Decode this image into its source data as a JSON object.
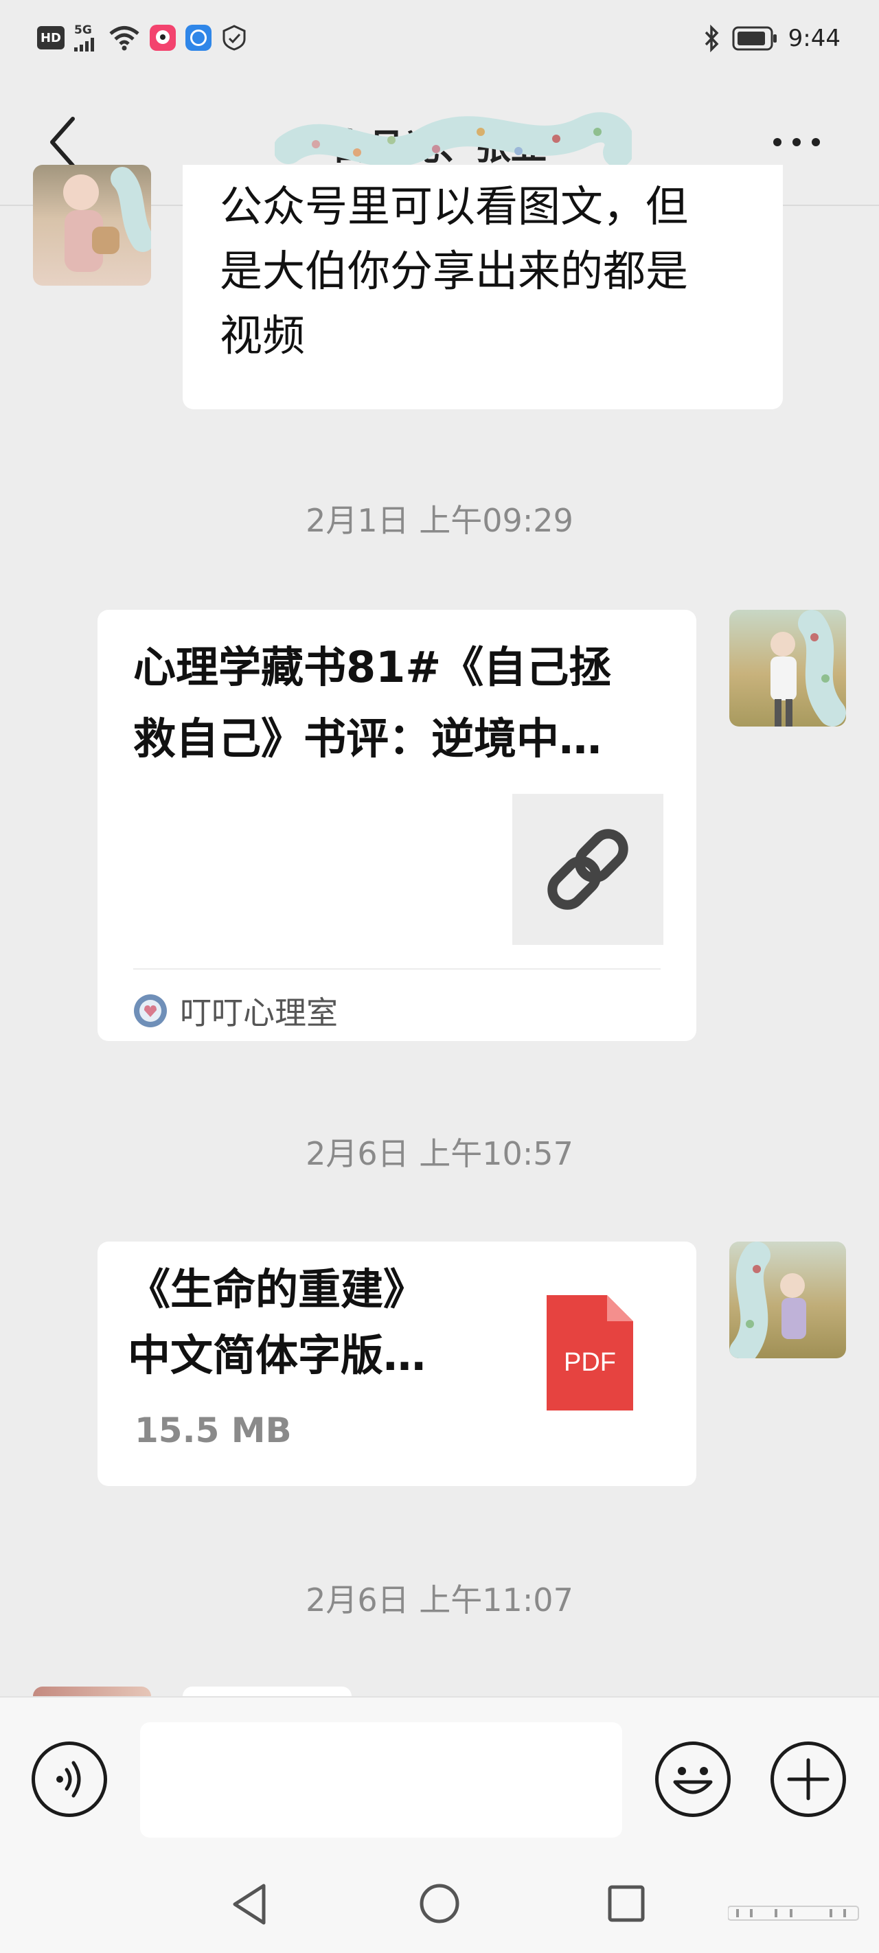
{
  "status_bar": {
    "hd": "HD",
    "network": "5G",
    "time": "9:44"
  },
  "nav": {
    "title": "白月光、张亚"
  },
  "messages": [
    {
      "type": "text",
      "side": "left",
      "text_lines": [
        "公众号里可以看图文，但",
        "是大伯你分享出来的都是",
        "视频"
      ]
    },
    {
      "type": "timestamp",
      "text": "2月1日 上午09:29"
    },
    {
      "type": "link",
      "side": "right",
      "title_lines": [
        "心理学藏书81#《自己拯",
        "救自己》书评：逆境中…"
      ],
      "source": "叮叮心理室"
    },
    {
      "type": "timestamp",
      "text": "2月6日 上午10:57"
    },
    {
      "type": "file",
      "side": "right",
      "name_lines": [
        "《生命的重建》",
        "中文简体字版…"
      ],
      "size": "15.5 MB",
      "file_type": "PDF"
    },
    {
      "type": "timestamp",
      "text": "2月6日 上午11:07"
    }
  ],
  "input_bar": {
    "placeholder": ""
  },
  "colors": {
    "background": "#ededed",
    "pdf_red": "#e64340",
    "bubble": "#ffffff"
  },
  "icons": {
    "voice": "voice-icon",
    "emoji": "emoji-icon",
    "plus": "plus-icon",
    "link": "link-icon",
    "pdf": "pdf-file-icon"
  }
}
